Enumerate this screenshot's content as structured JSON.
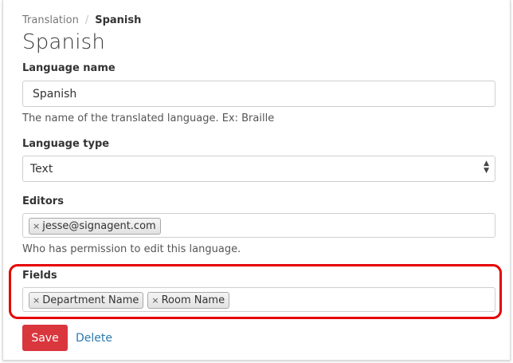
{
  "breadcrumb": {
    "parent": "Translation",
    "separator": "/",
    "current": "Spanish"
  },
  "page_title": "Spanish",
  "language_name": {
    "label": "Language name",
    "value": "Spanish",
    "help": "The name of the translated language. Ex: Braille"
  },
  "language_type": {
    "label": "Language type",
    "selected": "Text"
  },
  "editors": {
    "label": "Editors",
    "tags": [
      "jesse@signagent.com"
    ],
    "help": "Who has permission to edit this language."
  },
  "fields": {
    "label": "Fields",
    "tags": [
      "Department Name",
      "Room Name"
    ]
  },
  "actions": {
    "save_label": "Save",
    "delete_label": "Delete"
  },
  "tag_remove_glyph": "×",
  "colors": {
    "save_button": "#d9363e",
    "link": "#2a7ab0",
    "highlight": "#e60000"
  }
}
